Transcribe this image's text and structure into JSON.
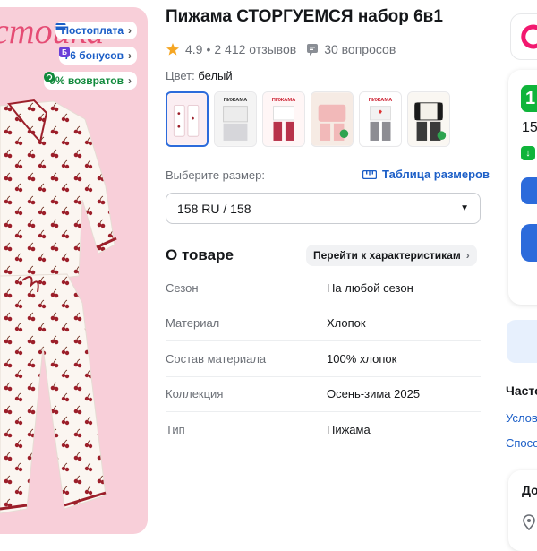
{
  "product": {
    "title": "Пижама СТОРГУЕМСЯ набор 6в1",
    "rating": "4.9",
    "reviews": "2 412 отзывов",
    "questions": "30 вопросов",
    "separator": "•"
  },
  "hero": {
    "banner_text": "стоика",
    "badges": [
      {
        "label": "Постоплата",
        "icon": "postpay-icon"
      },
      {
        "label": "76 бонусов",
        "icon": "bonus-icon"
      },
      {
        "label": "0% возвратов",
        "icon": "return-icon"
      }
    ]
  },
  "color": {
    "label": "Цвет:",
    "value": "белый"
  },
  "thumbnails": [
    {
      "label": "",
      "selected": true
    },
    {
      "label": "ПИЖАМА",
      "selected": false
    },
    {
      "label": "ПИЖАМА",
      "selected": false
    },
    {
      "label": "",
      "selected": false
    },
    {
      "label": "ПИЖАМА",
      "selected": false
    },
    {
      "label": "",
      "selected": false
    }
  ],
  "size": {
    "label": "Выберите размер:",
    "table_link": "Таблица размеров",
    "selected": "158 RU / 158"
  },
  "about": {
    "title": "О товаре",
    "characteristics_link": "Перейти к характеристикам",
    "specs": [
      {
        "key": "Сезон",
        "value": "На любой сезон"
      },
      {
        "key": "Материал",
        "value": "Хлопок"
      },
      {
        "key": "Состав материала",
        "value": "100% хлопок"
      },
      {
        "key": "Коллекция",
        "value": "Осень-зима 2025"
      },
      {
        "key": "Тип",
        "value": "Пижама"
      }
    ]
  },
  "right_panel": {
    "green_badge": "1",
    "price_fragment": "15",
    "heading": "Часто",
    "links": [
      "Услов",
      "Спосо"
    ],
    "heading2": "До"
  },
  "colors": {
    "accent_blue": "#2c6bdb",
    "link_blue": "#1b5ec7",
    "green": "#0fb43a",
    "hero_pink": "#f8cfd9",
    "star": "#f5a623"
  }
}
